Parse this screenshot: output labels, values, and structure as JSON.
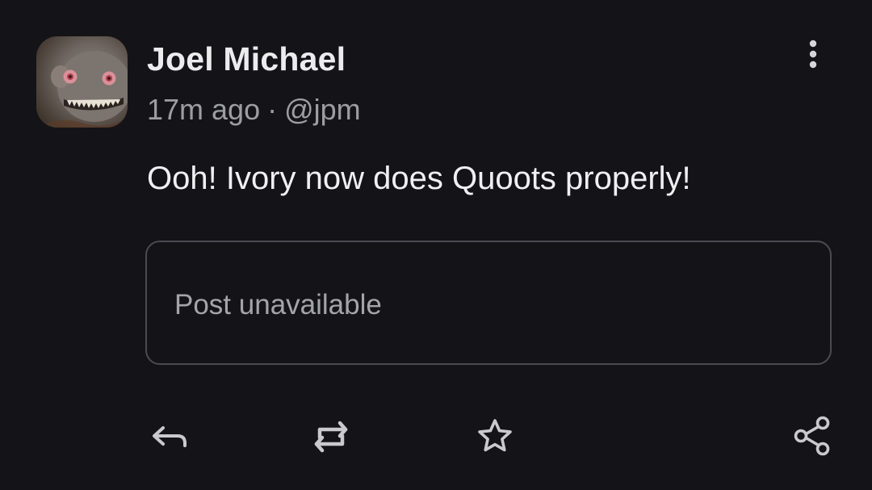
{
  "post": {
    "author_name": "Joel Michael",
    "time_ago": "17m ago",
    "separator": "·",
    "handle": "@jpm",
    "content": "Ooh! Ivory now does Quoots properly!",
    "quote": {
      "text": "Post unavailable"
    }
  },
  "icons": {
    "avatar": "fish-avatar",
    "more": "more-vertical-icon",
    "reply": "reply-icon",
    "boost": "boost-icon",
    "favorite": "star-icon",
    "share": "share-icon"
  },
  "colors": {
    "background": "#141418",
    "primary_text": "#ececef",
    "secondary_text": "#9d9da4",
    "border": "#4a4a52"
  }
}
